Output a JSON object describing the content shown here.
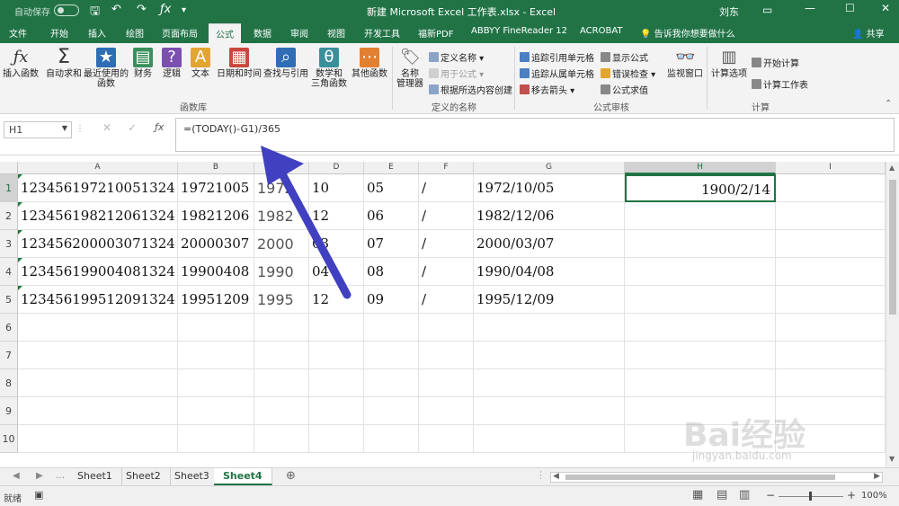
{
  "titlebar": {
    "autosave": "自动保存",
    "title": "新建 Microsoft Excel 工作表.xlsx  -  Excel",
    "user": "刘东",
    "minimize": "—",
    "restore": "☐",
    "close": "✕"
  },
  "tabs": [
    "文件",
    "开始",
    "插入",
    "绘图",
    "页面布局",
    "公式",
    "数据",
    "审阅",
    "视图",
    "开发工具",
    "福新PDF",
    "ABBYY FineReader 12",
    "ACROBAT"
  ],
  "tellme": "告诉我你想要做什么",
  "share": "共享",
  "ribbon": {
    "insert_func": "插入函数",
    "autosum": "自动求和",
    "recent": "最近使用的\n函数",
    "finance": "财务",
    "logic": "逻辑",
    "text": "文本",
    "datetime": "日期和时间",
    "lookup": "查找与引用",
    "math": "数学和\n三角函数",
    "other": "其他函数",
    "group_library": "函数库",
    "name_manager": "名称\n管理器",
    "define_name": "定义名称",
    "use_in_formula": "用于公式",
    "create_from_sel": "根据所选内容创建",
    "group_names": "定义的名称",
    "trace_prec": "追踪引用单元格",
    "trace_dep": "追踪从属单元格",
    "remove_arrows": "移去箭头",
    "show_formulas": "显示公式",
    "error_check": "错误检查",
    "eval_formula": "公式求值",
    "group_audit": "公式审核",
    "watch": "监视窗口",
    "calc_options": "计算选项",
    "calc_now": "开始计算",
    "calc_sheet": "计算工作表",
    "group_calc": "计算"
  },
  "namebox": "H1",
  "formula": "=(TODAY()-G1)/365",
  "columns": [
    "A",
    "B",
    "C",
    "D",
    "E",
    "F",
    "G",
    "H",
    "I"
  ],
  "rows": [
    "1",
    "2",
    "3",
    "4",
    "5",
    "6",
    "7",
    "8",
    "9",
    "10"
  ],
  "cells": [
    [
      "123456197210051324",
      "19721005",
      "1972",
      "10",
      "05",
      "/",
      "1972/10/05",
      "1900/2/14"
    ],
    [
      "123456198212061324",
      "19821206",
      "1982",
      "12",
      "06",
      "/",
      "1982/12/06",
      ""
    ],
    [
      "123456200003071324",
      "20000307",
      "2000",
      "03",
      "07",
      "/",
      "2000/03/07",
      ""
    ],
    [
      "123456199004081324",
      "19900408",
      "1990",
      "04",
      "08",
      "/",
      "1990/04/08",
      ""
    ],
    [
      "123456199512091324",
      "19951209",
      "1995",
      "12",
      "09",
      "/",
      "1995/12/09",
      ""
    ]
  ],
  "sheets": [
    "Sheet1",
    "Sheet2",
    "Sheet3",
    "Sheet4"
  ],
  "status": {
    "ready": "就绪",
    "zoom": "100%"
  },
  "watermark": {
    "logo": "Bai经验",
    "url": "jingyan.baidu.com"
  },
  "colors": {
    "accent": "#217346",
    "arrow": "#4040c0"
  }
}
